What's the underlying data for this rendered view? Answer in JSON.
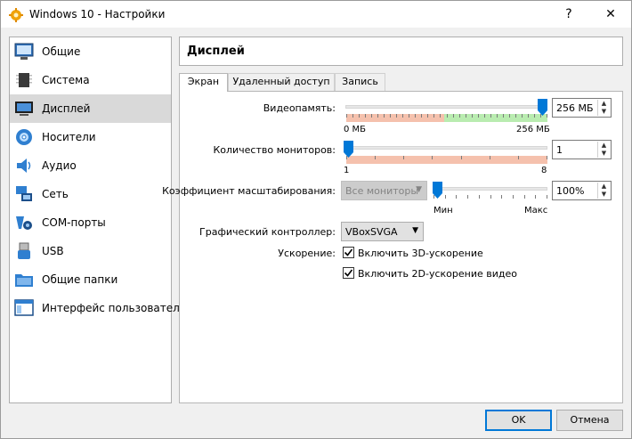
{
  "window": {
    "title": "Windows 10 - Настройки",
    "help_glyph": "?",
    "close_glyph": "✕"
  },
  "sidebar": {
    "items": [
      {
        "label": "Общие",
        "icon": "general-icon",
        "active": false
      },
      {
        "label": "Система",
        "icon": "system-icon",
        "active": false
      },
      {
        "label": "Дисплей",
        "icon": "display-icon",
        "active": true
      },
      {
        "label": "Носители",
        "icon": "storage-icon",
        "active": false
      },
      {
        "label": "Аудио",
        "icon": "audio-icon",
        "active": false
      },
      {
        "label": "Сеть",
        "icon": "network-icon",
        "active": false
      },
      {
        "label": "COM-порты",
        "icon": "serial-ports-icon",
        "active": false
      },
      {
        "label": "USB",
        "icon": "usb-icon",
        "active": false
      },
      {
        "label": "Общие папки",
        "icon": "shared-folders-icon",
        "active": false
      },
      {
        "label": "Интерфейс пользователя",
        "icon": "user-interface-icon",
        "active": false
      }
    ]
  },
  "header": {
    "title": "Дисплей"
  },
  "tabs": [
    {
      "label": "Экран",
      "active": true
    },
    {
      "label": "Удаленный доступ",
      "active": false
    },
    {
      "label": "Запись",
      "active": false
    }
  ],
  "screen": {
    "video_memory": {
      "label": "Видеопамять:",
      "value": "256 МБ",
      "min_label": "0 МБ",
      "max_label": "256 МБ",
      "level": 1.0
    },
    "monitors": {
      "label": "Количество мониторов:",
      "value": "1",
      "min_label": "1",
      "max_label": "8",
      "level": 0.0
    },
    "scale": {
      "label": "Коэффициент масштабирования:",
      "combo_value": "Все мониторы",
      "value": "100%",
      "min_label": "Мин",
      "max_label": "Макс",
      "level": 0.0
    },
    "controller": {
      "label": "Графический контроллер:",
      "value": "VBoxSVGA"
    },
    "acceleration": {
      "label": "Ускорение:",
      "enable_3d": "Включить 3D-ускорение",
      "enable_3d_checked": true,
      "enable_2d": "Включить 2D-ускорение видео",
      "enable_2d_checked": true
    }
  },
  "buttons": {
    "ok": "OK",
    "cancel": "Отмена"
  },
  "colors": {
    "accent": "#0078d7",
    "active_item": "#d9d9d9",
    "range_red": "#f5c1ad",
    "range_green": "#b9ecb0"
  }
}
